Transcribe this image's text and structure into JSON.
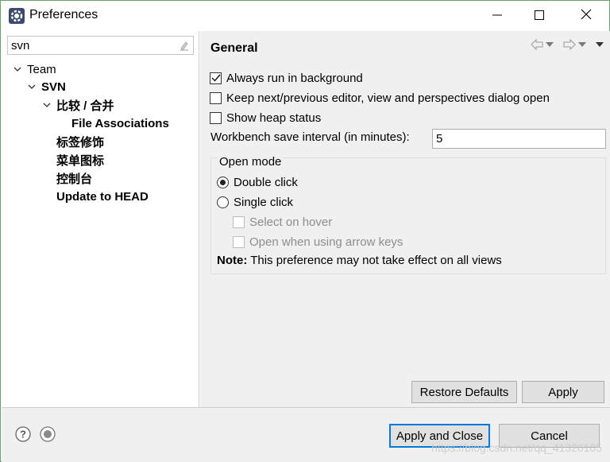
{
  "window": {
    "title": "Preferences",
    "icon": "gear-icon"
  },
  "filter": {
    "value": "svn"
  },
  "tree": {
    "items": [
      {
        "label": "Team",
        "expanded": true
      },
      {
        "label": "SVN",
        "expanded": true
      },
      {
        "label": "比较 / 合并",
        "expanded": true
      },
      {
        "label": "File Associations"
      },
      {
        "label": "标签修饰"
      },
      {
        "label": "菜单图标"
      },
      {
        "label": "控制台"
      },
      {
        "label": "Update to HEAD"
      }
    ]
  },
  "page": {
    "title": "General",
    "options": {
      "always_run": {
        "label": "Always run in background",
        "checked": true
      },
      "keep_next_prev": {
        "label": "Keep next/previous editor, view and perspectives dialog open",
        "checked": false
      },
      "show_heap": {
        "label": "Show heap status",
        "checked": false
      }
    },
    "interval": {
      "label": "Workbench save interval (in minutes):",
      "value": "5"
    },
    "open_mode": {
      "title": "Open mode",
      "double_click": "Double click",
      "single_click": "Single click",
      "selected": "Double click",
      "select_on_hover": "Select on hover",
      "open_arrow_keys": "Open when using arrow keys",
      "note_bold": "Note:",
      "note_text": " This preference may not take effect on all views"
    },
    "restore_defaults": "Restore Defaults",
    "apply": "Apply"
  },
  "footer": {
    "apply_close": "Apply and Close",
    "cancel": "Cancel",
    "watermark": "https://blog.csdn.net/qq_41320105"
  },
  "colors": {
    "accent": "#0078d7",
    "window_border": "#6a9e6a",
    "panel_bg": "#f0f0f0"
  }
}
